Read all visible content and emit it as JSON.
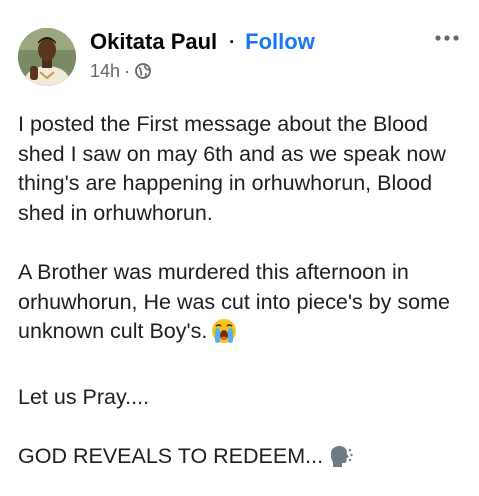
{
  "post": {
    "author": {
      "name": "Okitata Paul",
      "separator": "·",
      "follow_label": "Follow"
    },
    "meta": {
      "time": "14h",
      "separator": "·",
      "audience_icon": "globe-icon"
    },
    "more_icon": "more-options-icon",
    "text": {
      "p1": "I posted the First message about the Blood shed I saw on may 6th and as we speak now thing's are happening in orhuwhorun, Blood shed in orhuwhorun.",
      "p2": "A Brother was murdered this afternoon in orhuwhorun, He was cut into piece's by some unknown cult Boy's.",
      "p2_emoji": "loudly-crying-face-emoji",
      "p3": "Let us Pray....",
      "p4": "GOD REVEALS TO REDEEM...",
      "p4_emoji": "speaking-head-emoji"
    },
    "colors": {
      "accent": "#1877f2",
      "text": "#1c1e21",
      "secondary": "#65676b"
    }
  }
}
